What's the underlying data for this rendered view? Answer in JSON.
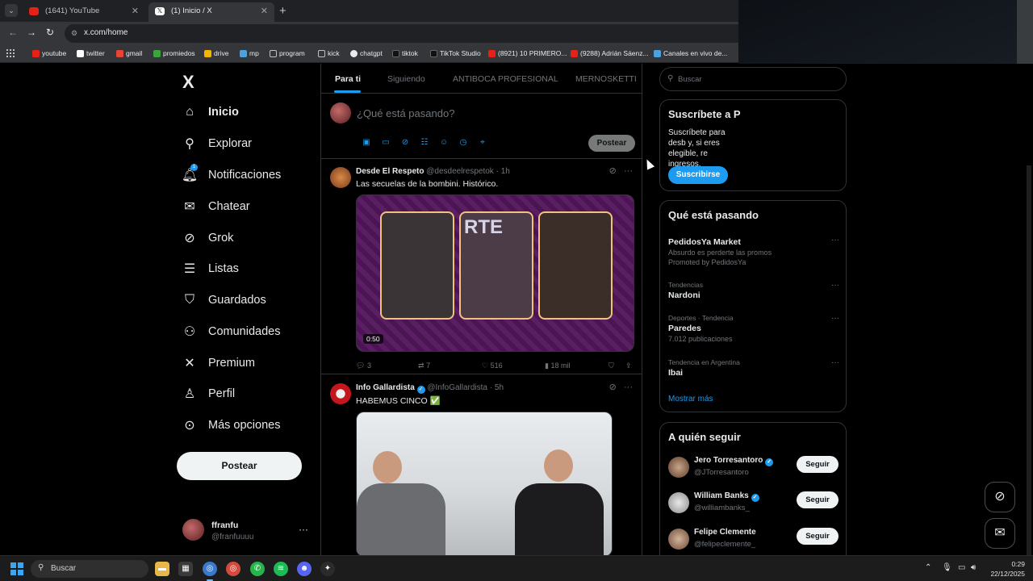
{
  "browser": {
    "tabs": [
      {
        "title": "(1641) YouTube",
        "active": false
      },
      {
        "title": "(1) Inicio / X",
        "active": true
      }
    ],
    "url": "x.com/home",
    "bookmarks": [
      "youtube",
      "twitter",
      "gmail",
      "promiedos",
      "drive",
      "mp",
      "program",
      "kick",
      "chatgpt",
      "tiktok",
      "TikTok Studio",
      "(8921) 10 PRIMERO...",
      "(9288) Adrián Sáenz...",
      "Canales en vivo de..."
    ]
  },
  "sidebar": {
    "logo": "X",
    "items": [
      {
        "label": "Inicio",
        "icon": "home-icon"
      },
      {
        "label": "Explorar",
        "icon": "search-icon"
      },
      {
        "label": "Notificaciones",
        "icon": "bell-icon",
        "badge": "1"
      },
      {
        "label": "Chatear",
        "icon": "mail-icon"
      },
      {
        "label": "Grok",
        "icon": "grok-icon"
      },
      {
        "label": "Listas",
        "icon": "list-icon"
      },
      {
        "label": "Guardados",
        "icon": "bookmark-icon"
      },
      {
        "label": "Comunidades",
        "icon": "people-icon"
      },
      {
        "label": "Premium",
        "icon": "x-icon"
      },
      {
        "label": "Perfil",
        "icon": "person-icon"
      },
      {
        "label": "Más opciones",
        "icon": "more-circle-icon"
      }
    ],
    "post_button": "Postear",
    "user": {
      "name": "ffranfu",
      "handle": "@franfuuuu"
    }
  },
  "feed": {
    "tabs": [
      "Para ti",
      "Siguiendo",
      "ANTIBOCA PROFESIONAL",
      "MERNOSKETTI"
    ],
    "composer": {
      "placeholder": "¿Qué está pasando?",
      "post_label": "Postear"
    },
    "tweets": [
      {
        "name": "Desde El Respeto",
        "handle": "@desdeelrespetok",
        "time": "1h",
        "text": "Las secuelas de la bombini. Histórico.",
        "video_duration": "0:50",
        "media_text": "RTE",
        "replies": "3",
        "retweets": "7",
        "likes": "516",
        "views": "18 mil"
      },
      {
        "name": "Info Gallardista",
        "handle": "@InfoGallardista",
        "time": "5h",
        "text": "HABEMUS CINCO ✅",
        "verified": true
      }
    ]
  },
  "right": {
    "search_placeholder": "Buscar",
    "subscribe": {
      "title": "Suscríbete a P",
      "text": "Suscríbete para desb y, si eres elegible, re ingresos.",
      "button": "Suscribirse"
    },
    "trends": {
      "title": "Qué está pasando",
      "items": [
        {
          "context": "",
          "title": "PedidosYa Market",
          "sub": "Absurdo es perderte las promos",
          "sub2": "Promoted by PedidosYa"
        },
        {
          "context": "Tendencias",
          "title": "Nardoni",
          "sub": ""
        },
        {
          "context": "Deportes · Tendencia",
          "title": "Paredes",
          "sub": "7.012 publicaciones"
        },
        {
          "context": "Tendencia en Argentina",
          "title": "Ibai",
          "sub": ""
        }
      ],
      "show_more": "Mostrar más"
    },
    "who_to_follow": {
      "title": "A quién seguir",
      "follow_label": "Seguir",
      "users": [
        {
          "name": "Jero Torresantoro",
          "handle": "@JTorresantoro"
        },
        {
          "name": "William Banks",
          "handle": "@williambanks_"
        },
        {
          "name": "Felipe Clemente",
          "handle": "@felipeclemente_"
        }
      ]
    }
  },
  "taskbar": {
    "search": "Buscar",
    "time": "0:29",
    "date": "22/12/2025"
  }
}
